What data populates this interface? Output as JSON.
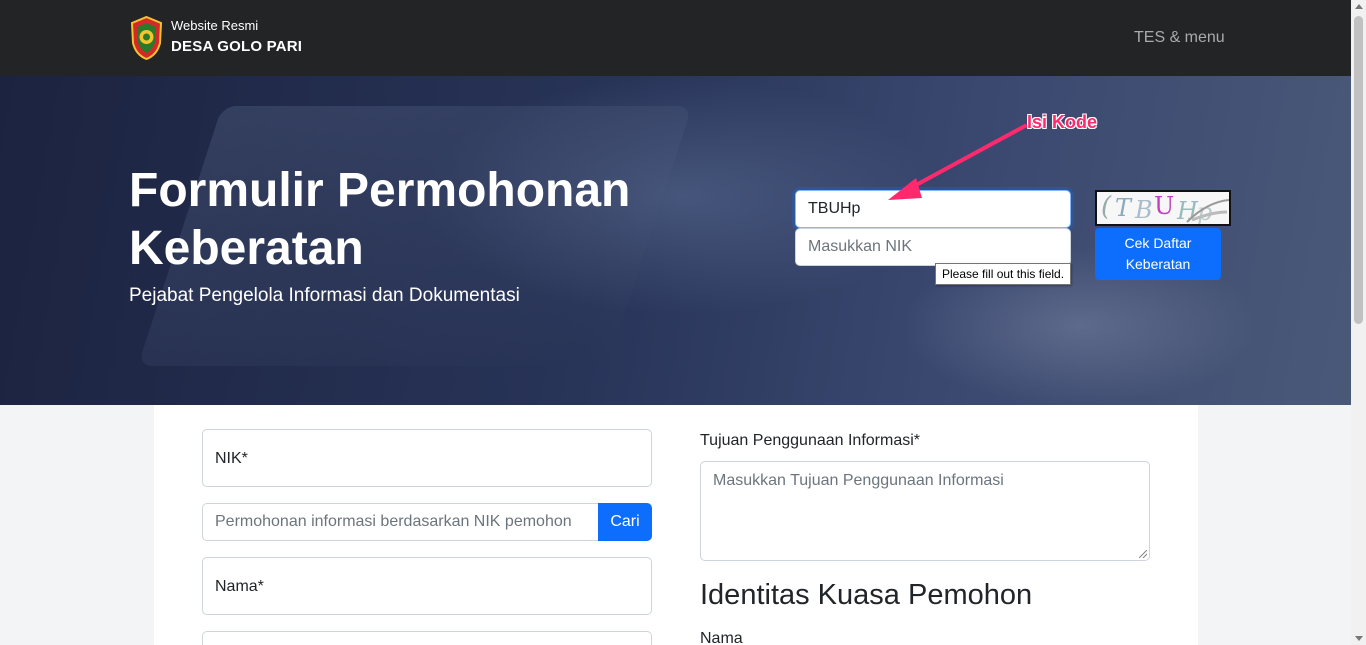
{
  "navbar": {
    "brand_small": "Website Resmi",
    "brand_big": "DESA GOLO PARI",
    "menu_label": "TES & menu",
    "logo_icon": "village-crest-logo"
  },
  "hero": {
    "title": "Formulir Permohonan Keberatan",
    "subtitle": "Pejabat Pengelola Informasi dan Dokumentasi",
    "captcha_value": "TBUHp",
    "nik_placeholder": "Masukkan NIK",
    "tooltip": "Please fill out this field.",
    "captcha_image_text": "TBUHp",
    "check_button": "Cek Daftar Keberatan",
    "annotation": "Isi Kode"
  },
  "form": {
    "nik_label": "NIK*",
    "search_placeholder": "Permohonan informasi berdasarkan NIK pemohon",
    "search_button": "Cari",
    "nama_label": "Nama*",
    "tujuan_label": "Tujuan Penggunaan Informasi*",
    "tujuan_placeholder": "Masukkan Tujuan Penggunaan Informasi",
    "kuasa_heading": "Identitas Kuasa Pemohon",
    "kuasa_nama_label": "Nama"
  },
  "colors": {
    "navbar": "#222425",
    "primary": "#0d6efd",
    "annotation": "#ff2a6d"
  }
}
